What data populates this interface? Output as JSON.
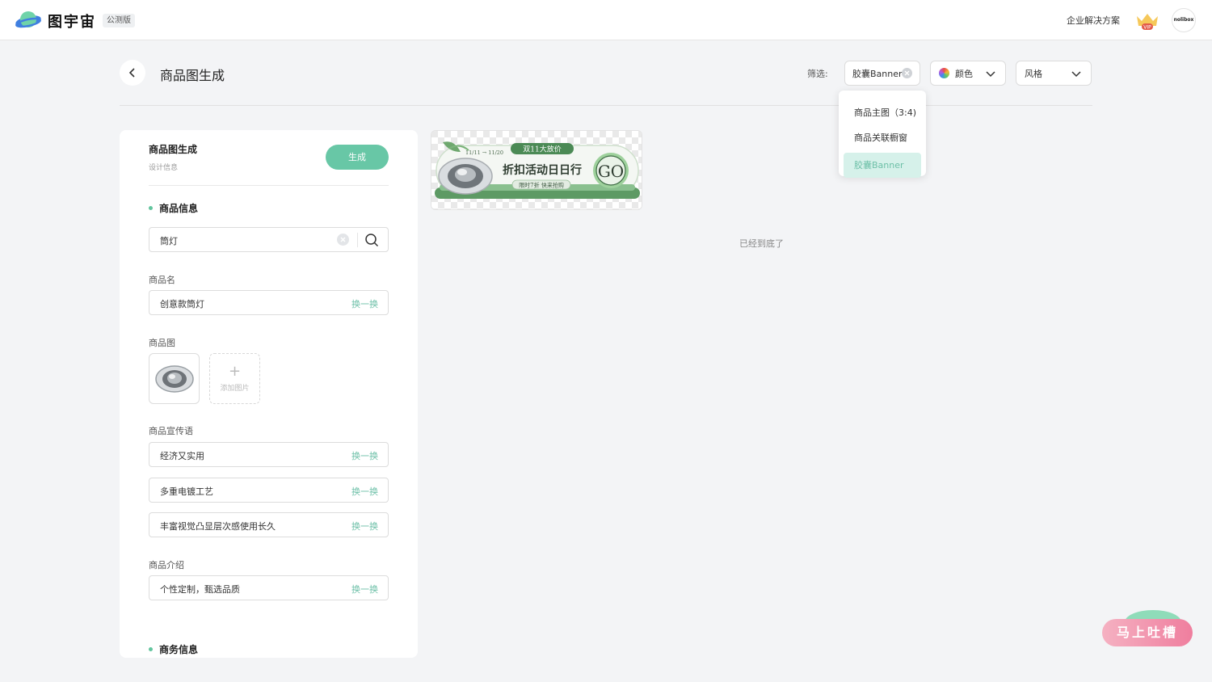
{
  "header": {
    "brand": "图宇宙",
    "beta_badge": "公测版",
    "enterprise_link": "企业解决方案",
    "vip_label": "VIP",
    "avatar_text": "nolibox"
  },
  "page": {
    "title": "商品图生成"
  },
  "filters": {
    "label": "筛选:",
    "type_value": "胶囊Banner",
    "color_label": "颜色",
    "style_label": "风格",
    "type_options": [
      "商品主图（3:4)",
      "商品关联橱窗",
      "胶囊Banner"
    ],
    "selected_index": 2
  },
  "panel": {
    "title": "商品图生成",
    "subtitle": "设计信息",
    "generate_button": "生成",
    "section_product": "商品信息",
    "search_value": "筒灯",
    "name_label": "商品名",
    "name_value": "创意款筒灯",
    "swap_label": "换一换",
    "image_label": "商品图",
    "add_image_label": "添加图片",
    "slogan_label": "商品宣传语",
    "slogans": [
      "经济又实用",
      "多重电镀工艺",
      "丰富视觉凸显层次感使用长久"
    ],
    "intro_label": "商品介绍",
    "intro_value": "个性定制，甄选品质",
    "section_business": "商务信息"
  },
  "banner": {
    "date_range": "11/11 → 11/20",
    "promo_tag": "双11大放价",
    "headline": "折扣活动日日行",
    "subline": "限时7折 快来抢购",
    "cta": "GO"
  },
  "results": {
    "end_message": "已经到底了"
  },
  "feedback": {
    "label": "马上吐槽"
  },
  "colors": {
    "accent": "#68c7a6",
    "accent_text": "#6ec0a8",
    "feedback_pink": "#ef7e9e"
  }
}
